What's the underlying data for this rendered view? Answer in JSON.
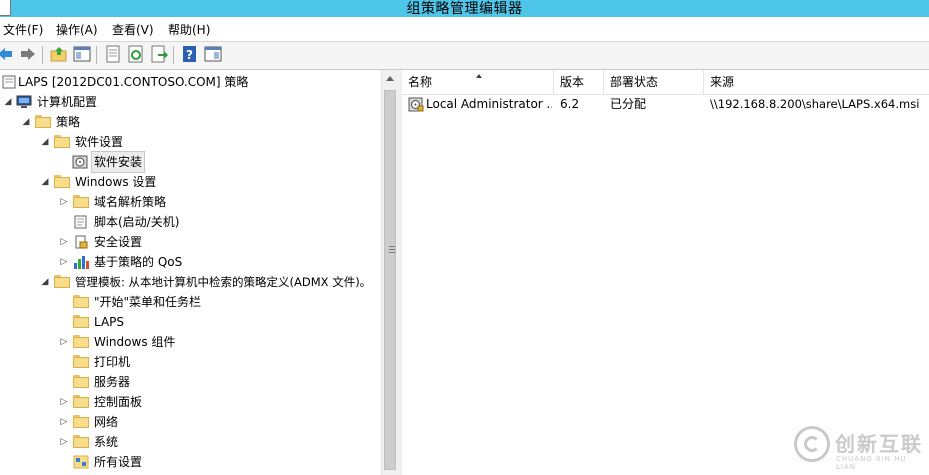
{
  "window": {
    "title": "组策略管理编辑器"
  },
  "menu": [
    "文件(F)",
    "操作(A)",
    "查看(V)",
    "帮助(H)"
  ],
  "toolbar": {
    "buttons": [
      "back-icon",
      "forward-icon",
      "up-folder-icon",
      "show-tree-icon",
      "properties-icon",
      "refresh-icon",
      "export-icon",
      "help-icon",
      "show-pane-icon"
    ]
  },
  "tree": {
    "root": "LAPS [2012DC01.CONTOSO.COM] 策略",
    "computer_config": "计算机配置",
    "policies": "策略",
    "software_settings": "软件设置",
    "software_install": "软件安装",
    "windows_settings": "Windows 设置",
    "name_resolution": "域名解析策略",
    "scripts": "脚本(启动/关机)",
    "security": "安全设置",
    "qos": "基于策略的 QoS",
    "admin_templates": "管理模板: 从本地计算机中检索的策略定义(ADMX 文件)。",
    "start_menu": "\"开始\"菜单和任务栏",
    "laps": "LAPS",
    "win_components": "Windows 组件",
    "printers": "打印机",
    "servers": "服务器",
    "control_panel": "控制面板",
    "network": "网络",
    "system": "系统",
    "all_settings": "所有设置"
  },
  "list": {
    "columns": [
      "名称",
      "版本",
      "部署状态",
      "来源"
    ],
    "rows": [
      {
        "name": "Local Administrator ...",
        "version": "6.2",
        "state": "已分配",
        "source": "\\\\192.168.8.200\\share\\LAPS.x64.msi"
      }
    ]
  },
  "watermark": {
    "text": "创新互联",
    "sub": "CHUANG XIN HU LIAN"
  }
}
